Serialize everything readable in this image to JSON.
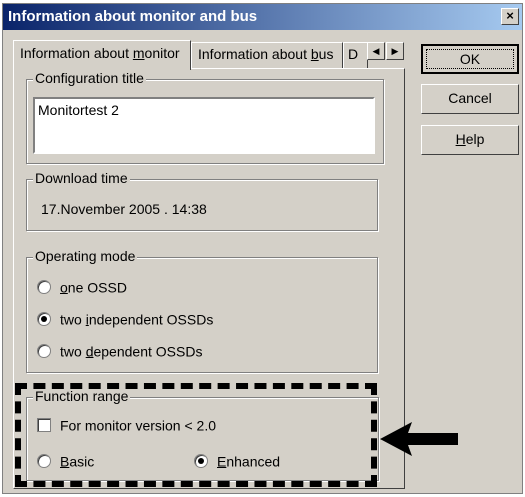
{
  "window": {
    "title": "Information about monitor and bus",
    "close_glyph": "×"
  },
  "tabs": [
    {
      "label_pre": "Information about ",
      "label_u": "m",
      "label_post": "onitor"
    },
    {
      "label_pre": "Information about ",
      "label_u": "b",
      "label_post": "us"
    },
    {
      "label": "D"
    }
  ],
  "tab_scroll": {
    "left": "◀",
    "right": "▶"
  },
  "config": {
    "legend": "Configuration title",
    "value": "Monitortest 2"
  },
  "download": {
    "legend": "Download time",
    "value": "17.November 2005  .  14:38"
  },
  "operating_mode": {
    "legend": "Operating mode",
    "options": [
      {
        "pre": "",
        "u": "o",
        "post": "ne OSSD",
        "selected": false
      },
      {
        "pre": "two ",
        "u": "i",
        "post": "ndependent OSSDs",
        "selected": true
      },
      {
        "pre": "two ",
        "u": "d",
        "post": "ependent OSSDs",
        "selected": false
      }
    ]
  },
  "function_range": {
    "legend": "Function range",
    "checkbox_label": "For monitor version < 2.0",
    "checked": false,
    "basic": {
      "u": "B",
      "post": "asic",
      "selected": false
    },
    "enhanced": {
      "u": "E",
      "post": "nhanced",
      "selected": true
    }
  },
  "buttons": {
    "ok": "OK",
    "cancel": "Cancel",
    "help_u": "H",
    "help_post": "elp"
  },
  "colors": {
    "dialog_face": "#d4d0c8",
    "titlebar_start": "#0a246a",
    "titlebar_end": "#a6caf0",
    "highlight": "#000000"
  }
}
